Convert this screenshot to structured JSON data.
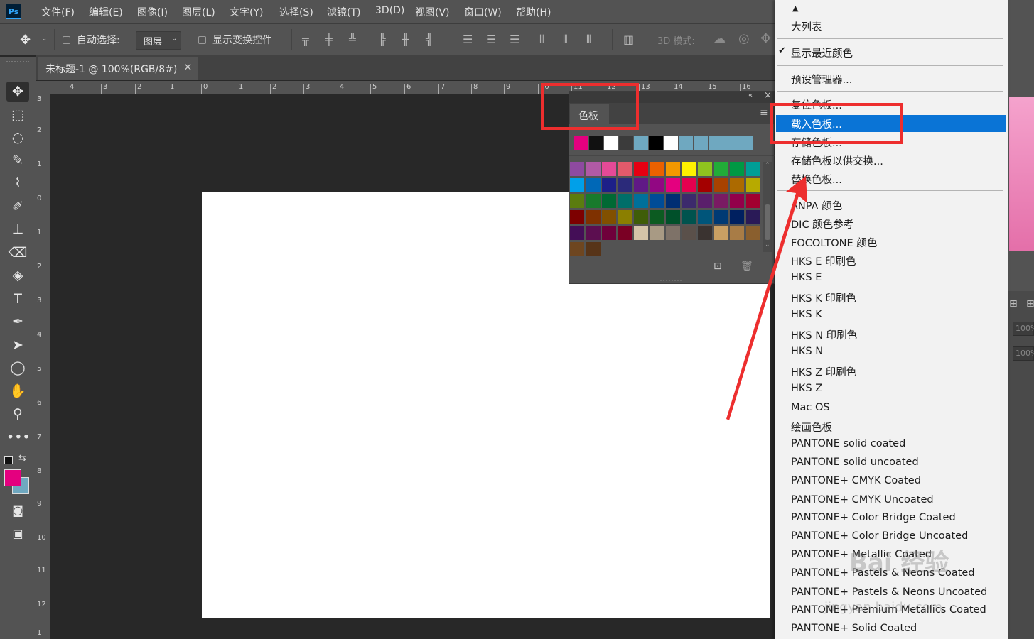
{
  "app": {
    "logo": "Ps",
    "menus": [
      "文件(F)",
      "编辑(E)",
      "图像(I)",
      "图层(L)",
      "文字(Y)",
      "选择(S)",
      "滤镜(T)",
      "3D(D)",
      "视图(V)",
      "窗口(W)",
      "帮助(H)"
    ]
  },
  "options_bar": {
    "auto_select_label": "自动选择:",
    "layer_select_value": "图层",
    "show_transform_label": "显示变换控件",
    "mode_3d_label": "3D 模式:"
  },
  "document": {
    "tab_title": "未标题-1 @ 100%(RGB/8#)",
    "tab_close": "×",
    "canvas_color": "#ffffff"
  },
  "ruler": {
    "h_ticks": [
      "4",
      "3",
      "2",
      "1",
      "0",
      "1",
      "2",
      "3",
      "4",
      "5",
      "6",
      "7",
      "8",
      "9",
      "10",
      "11",
      "12",
      "13",
      "14",
      "15",
      "16"
    ],
    "v_ticks": [
      "3",
      "2",
      "1",
      "0",
      "1",
      "2",
      "3",
      "4",
      "5",
      "6",
      "7",
      "8",
      "9",
      "10",
      "11",
      "12",
      "1"
    ]
  },
  "swatches_panel": {
    "tab_label": "色板",
    "recent_colors": [
      "#e4007f",
      "#111111",
      "#ffffff",
      "#3b3b3b",
      "#6fa8c0",
      "#000000",
      "#ffffff",
      "#6fa8c0",
      "#6fa8c0",
      "#6fa8c0",
      "#6fa8c0",
      "#6fa8c0"
    ],
    "grid_colors": [
      "#8e4aa0",
      "#b05aa5",
      "#e44a97",
      "#e25a6b",
      "#e60012",
      "#eb6100",
      "#f39800",
      "#fff100",
      "#8fc31f",
      "#22ac38",
      "#009944",
      "#009e96",
      "#00a0e9",
      "#0068b7",
      "#1d2088",
      "#2b2a7a",
      "#601986",
      "#920783",
      "#e4007f",
      "#e5004f",
      "#a40000",
      "#a84200",
      "#ac6a00",
      "#b7aa00",
      "#5b7c0f",
      "#187a2c",
      "#006934",
      "#006e69",
      "#00709b",
      "#004c97",
      "#002e73",
      "#3c2a6c",
      "#5a1f6b",
      "#7a1a63",
      "#93004a",
      "#a10030",
      "#7d0000",
      "#7f3100",
      "#815000",
      "#8b7f00",
      "#3f5d08",
      "#0c5b21",
      "#00502a",
      "#00534e",
      "#00557a",
      "#003a74",
      "#002060",
      "#2a1a57",
      "#440e57",
      "#5c0e50",
      "#6f003b",
      "#7a0024",
      "#d4c4a8",
      "#a89a84",
      "#7e7268",
      "#5a504a",
      "#3a3330",
      "#c9a063",
      "#a87c46",
      "#8a5f2e",
      "#6e4620",
      "#573418"
    ]
  },
  "dropdown_menu": {
    "items": [
      "大列表",
      "显示最近颜色",
      "预设管理器...",
      "复位色板...",
      "载入色板...",
      "存储色板...",
      "存储色板以供交换...",
      "替换色板...",
      "ANPA 颜色",
      "DIC 颜色参考",
      "FOCOLTONE 颜色",
      "HKS E 印刷色",
      "HKS E",
      "HKS K 印刷色",
      "HKS K",
      "HKS N 印刷色",
      "HKS N",
      "HKS Z 印刷色",
      "HKS Z",
      "Mac OS",
      "绘画色板",
      "PANTONE solid coated",
      "PANTONE solid uncoated",
      "PANTONE+ CMYK Coated",
      "PANTONE+ CMYK Uncoated",
      "PANTONE+ Color Bridge Coated",
      "PANTONE+ Color Bridge Uncoated",
      "PANTONE+ Metallic Coated",
      "PANTONE+ Pastels & Neons Coated",
      "PANTONE+ Pastels & Neons Uncoated",
      "PANTONE+ Premium Metallics Coated",
      "PANTONE+ Solid Coated"
    ],
    "highlighted": "载入色板..."
  },
  "right_panel": {
    "zoom_1": "100%",
    "zoom_2": "100%"
  },
  "watermark": {
    "text_1": "Bai 经验",
    "text_2": "jingyan.baidu.com"
  },
  "colors": {
    "foreground": "#e4007f",
    "background": "#6fa8c0",
    "highlight": "#0a74d6",
    "annotation_red": "#ed2e2e"
  }
}
